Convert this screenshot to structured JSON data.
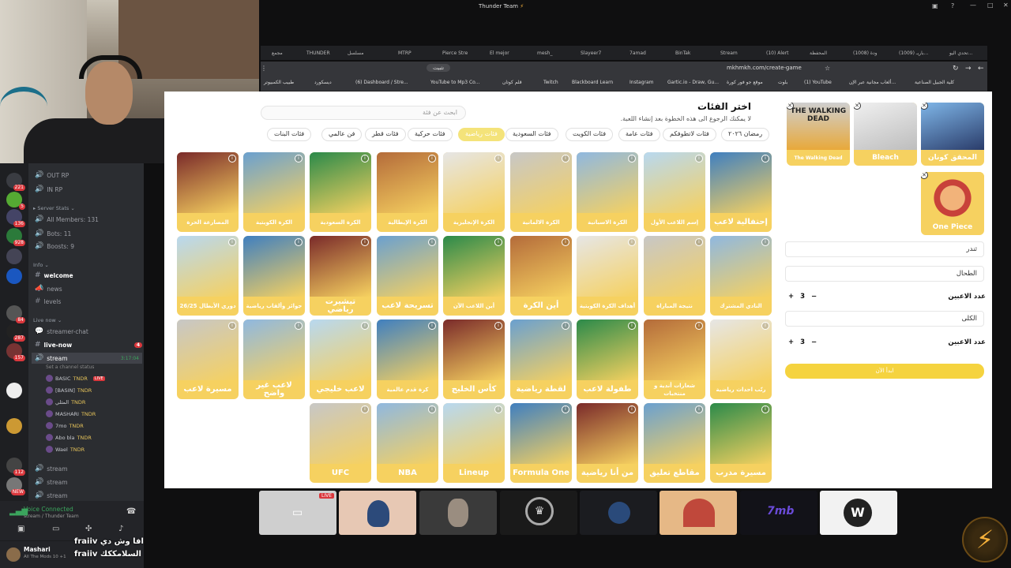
{
  "window": {
    "title": "Thunder Team"
  },
  "browser": {
    "tabs": [
      "تحدي اليو...",
      "(1009) باريـ...",
      "(1008) ودة",
      "المحفظة",
      "(10) Alert",
      "Stream",
      "BinTak",
      "7amad",
      "Slayeer7",
      "mesh_",
      "El mejor",
      "Pierce Stre",
      "MTRP",
      "مسلسل",
      "THUNDER",
      "مجمع"
    ],
    "url": "mkhmkh.com/create-game",
    "install_label": "تثبيت",
    "bookmarks": [
      "كلية الجبيل الصناعية",
      "ألعاب مجانية عبر الإن...",
      "(1) YouTube",
      "بلوت",
      "موقع جو فور كورة",
      "Gartic.io - Draw, Gu...",
      "Instagram",
      "Blackboard Learn",
      "Twitch",
      "قلم كوتان",
      "YouTube to Mp3 Co...",
      "(6) Dashboard / Stre...",
      "ديسكورد",
      "طبيب الكمبيوتر"
    ]
  },
  "page": {
    "title": "اختر الفئات",
    "subtitle": "لا يمكنك الرجوع الى هذه الخطوة بعد إنشاء اللعبة.",
    "search_placeholder": "ابحث عن فئة",
    "chips": [
      {
        "label": "رمضان ٢٠٢٦",
        "active": false
      },
      {
        "label": "فئات لاتطوفكم",
        "active": false
      },
      {
        "label": "فئات عامة",
        "active": false
      },
      {
        "label": "فئات الكويت",
        "active": false
      },
      {
        "label": "فئات السعودية",
        "active": false
      },
      {
        "label": "فئات رياضية",
        "active": true
      },
      {
        "label": "فئات حركية",
        "active": false
      },
      {
        "label": "فئات قطر",
        "active": false
      },
      {
        "label": "فن عالمي",
        "active": false
      },
      {
        "label": "فئات البنات",
        "active": false
      }
    ],
    "cards": [
      [
        "إحتفالية لاعب",
        "إسم اللاعب الأول",
        "الكرة الاسبانية",
        "الكرة الالمانية",
        "الكرة الإنجليزية",
        "الكرة الإيطالية",
        "الكرة السعودية",
        "الكرة الكويتية",
        "المصارعة الحرة"
      ],
      [
        "النادي المشترك",
        "نتيجة المباراة",
        "أهداف الكرة الكويتية",
        "أين الكرة",
        "أين اللاعب الآن",
        "تسريحة لاعب",
        "تيشيرت رياضي",
        "جوائز وألقاب رياضية",
        "دوري الأبطال 26/25"
      ],
      [
        "رتّب احداث رياضية",
        "شعارات أندية و منتخبات",
        "طفولة لاعب",
        "لقطة رياضية",
        "كأس الخليج",
        "كرة قدم عالمية",
        "لاعب خليجي",
        "لاعب غير واضح",
        "مسيرة لاعب"
      ],
      [
        "مسيرة مدرب",
        "مقاطع تعليق",
        "من أنا رياضية",
        "Formula One",
        "Lineup",
        "NBA",
        "UFC"
      ]
    ],
    "selected": [
      "المحقق كونان",
      "Bleach",
      "The Walking Dead",
      "One Piece"
    ],
    "selected_art_text": "THE WALKING DEAD",
    "team1": "ثندر",
    "team2": "الطحال",
    "players_label": "عدد الاعبين",
    "team3": "الكلى",
    "players1": "3",
    "players2": "3",
    "start_label": "ابدأ الآن"
  },
  "discord": {
    "channels_top": [
      "OUT RP",
      "IN RP"
    ],
    "server_stats_label": "Server Stats",
    "stats": [
      "All Members: 131",
      "Bots: 11",
      "Boosts: 9"
    ],
    "info_label": "Info",
    "info_channels": [
      "welcome",
      "news",
      "levels"
    ],
    "live_label": "Live now",
    "live_channels": [
      "streamer-chat",
      "live-now",
      "stream"
    ],
    "live_now_badge": "4",
    "stream_time": "3:17:04",
    "set_status": "Set a channel status",
    "users": [
      "BASIC",
      "[BASIN]",
      "المثلي",
      "MASHARI",
      "7mo",
      "Abo bla",
      "Wael"
    ],
    "tndr": "TNDR",
    "live_badge": "LIVE",
    "streams": [
      "stream",
      "stream",
      "stream"
    ],
    "voice_connected": "Voice Connected",
    "voice_channel": "stream / Thunder Team",
    "username": "Mashari",
    "user_status": "All The Mods 10 +1",
    "overlay_line1": "fraiiv  افا وش دي",
    "overlay_line2": "fraiiv  السلامككك",
    "guild_badges": [
      "221",
      "5",
      "136",
      "928",
      "84",
      "287",
      "157",
      "112",
      "NEW"
    ]
  },
  "strip": {
    "live": "LIVE",
    "tile_text": "7mb"
  }
}
